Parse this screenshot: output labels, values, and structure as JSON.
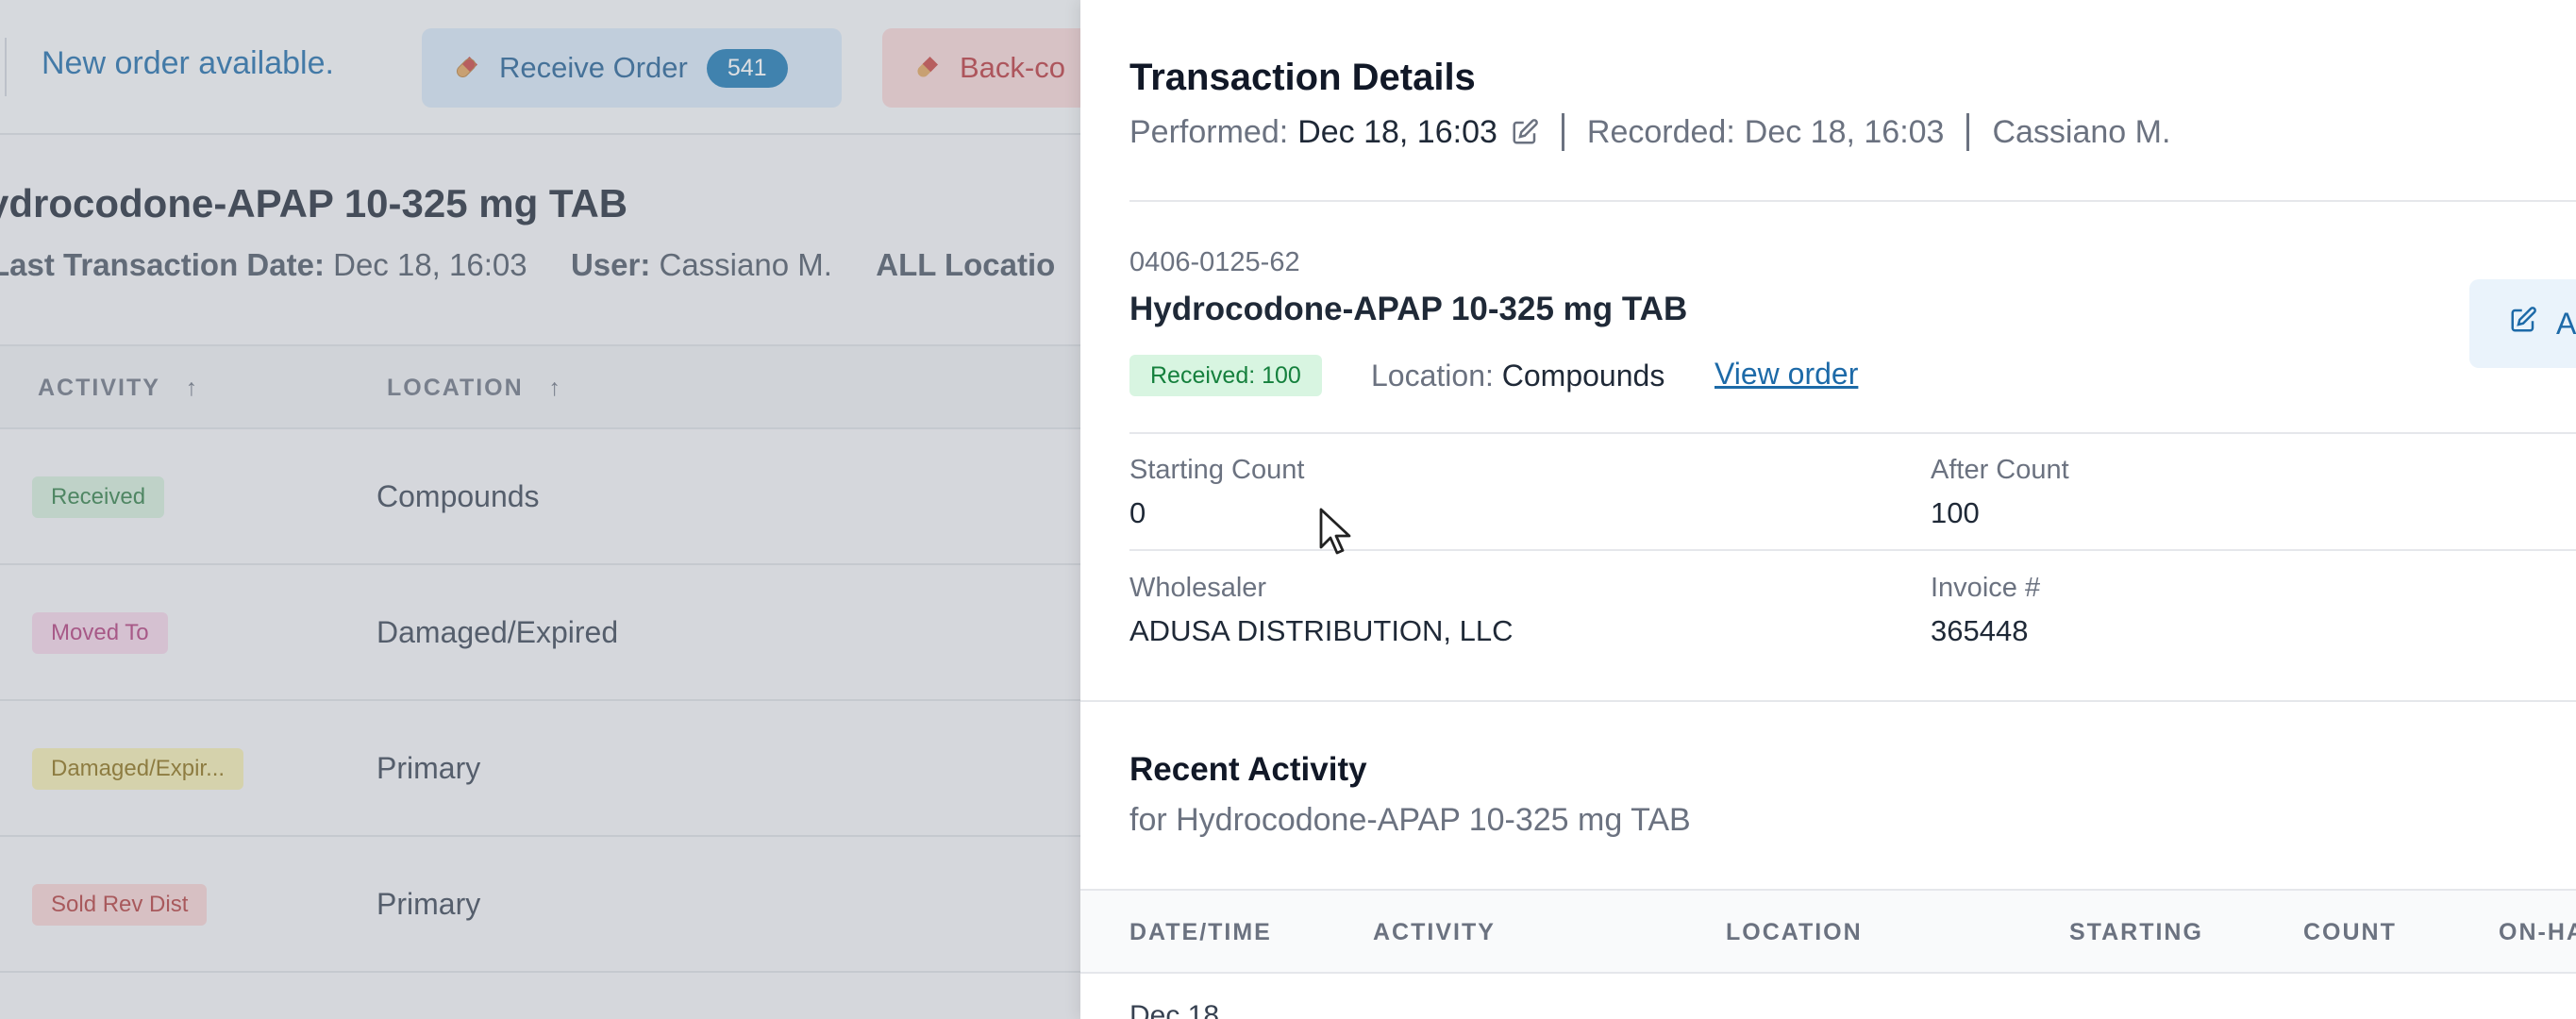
{
  "background": {
    "notice": "New order available.",
    "receive_button": {
      "label": "Receive Order",
      "count": "541"
    },
    "backorder_button": {
      "label": "Back-co"
    },
    "drug_title": "ydrocodone-APAP 10-325 mg TAB",
    "meta": {
      "last_tx_label": "Last Transaction Date:",
      "last_tx_value": "Dec 18, 16:03",
      "user_label": "User:",
      "user_value": "Cassiano M.",
      "locations_label": "ALL Locatio"
    },
    "table": {
      "headers": [
        "ACTIVITY",
        "LOCATION"
      ],
      "sort_icon": "↑",
      "rows": [
        {
          "activity": "Received",
          "location": "Compounds",
          "color": "#d3ecd9"
        },
        {
          "activity": "Moved To",
          "location": "Damaged/Expired",
          "color": "#f3d3e6"
        },
        {
          "activity": "Damaged/Expir...",
          "location": "Primary",
          "color": "#f4ecb0"
        },
        {
          "activity": "Sold Rev Dist",
          "location": "Primary",
          "color": "#f6d1d1"
        }
      ]
    }
  },
  "drawer": {
    "title": "Transaction Details",
    "performed_label": "Performed:",
    "performed_value": "Dec 18, 16:03",
    "recorded_label": "Recorded:",
    "recorded_value": "Dec 18, 16:03",
    "user": "Cassiano M.",
    "ndc": "0406-0125-62",
    "drug_name": "Hydrocodone-APAP 10-325 mg TAB",
    "received_badge": "Received: 100",
    "location_label": "Location:",
    "location_value": "Compounds",
    "view_order": "View order",
    "side_button_label": "A",
    "fields": {
      "starting_count_label": "Starting Count",
      "starting_count_value": "0",
      "after_count_label": "After Count",
      "after_count_value": "100",
      "wholesaler_label": "Wholesaler",
      "wholesaler_value": "ADUSA DISTRIBUTION, LLC",
      "invoice_label": "Invoice #",
      "invoice_value": "365448"
    },
    "recent_activity": {
      "title": "Recent Activity",
      "subtitle": "for Hydrocodone-APAP 10-325 mg TAB",
      "headers": [
        "DATE/TIME",
        "ACTIVITY",
        "LOCATION",
        "STARTING",
        "COUNT",
        "ON-HA"
      ],
      "first_row_date": "Dec 18"
    }
  },
  "icons": {
    "pill": "pill-icon",
    "edit": "edit-icon",
    "cursor": "mouse-pointer-icon"
  }
}
